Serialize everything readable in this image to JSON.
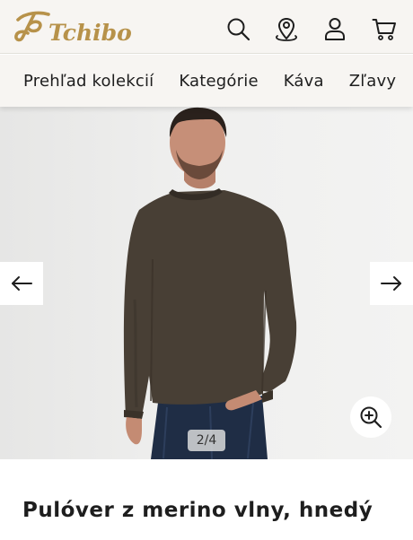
{
  "header": {
    "logo_text": "Tchibo",
    "icons": {
      "search": "search-icon",
      "store_locator": "location-pin-icon",
      "account": "user-icon",
      "cart": "cart-icon"
    },
    "brand_color": "#b7924a"
  },
  "nav": {
    "items": [
      {
        "label": "Prehľad kolekcií"
      },
      {
        "label": "Kategórie"
      },
      {
        "label": "Káva"
      },
      {
        "label": "Zľavy"
      }
    ]
  },
  "gallery": {
    "counter": "2/4",
    "current_image": 2,
    "total_images": 4,
    "prev_icon": "arrow-left-icon",
    "next_icon": "arrow-right-icon",
    "zoom_icon": "zoom-in-icon"
  },
  "product": {
    "title": "Pulóver z merino vlny, hnedý"
  }
}
